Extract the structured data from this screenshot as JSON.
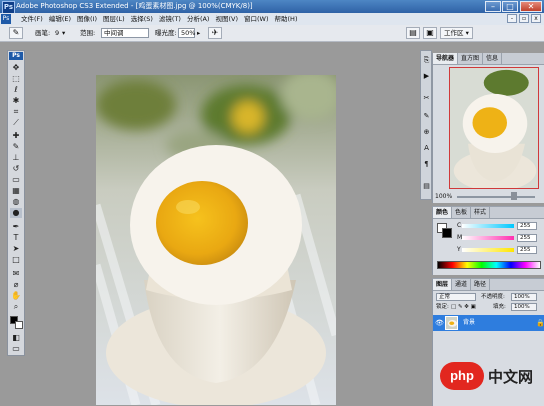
{
  "window": {
    "title": "Adobe Photoshop CS3 Extended - [鸡蛋素材图.jpg @ 100%(CMYK/8)]",
    "app_badge": "Ps"
  },
  "menu": {
    "items": [
      "文件(F)",
      "编辑(E)",
      "图像(I)",
      "图层(L)",
      "选择(S)",
      "滤镜(T)",
      "分析(A)",
      "视图(V)",
      "窗口(W)",
      "帮助(H)"
    ]
  },
  "options_bar": {
    "size_label": "画笔:",
    "size_value": "9",
    "range_label": "范围:",
    "range_value": "中间调",
    "exposure_label": "曝光度:",
    "exposure_value": "50%",
    "workspace_label": "工作区 ▾"
  },
  "toolbox": {
    "header": "Ps"
  },
  "navigator": {
    "tabs": [
      "导航器",
      "直方图",
      "信息"
    ],
    "zoom": "100%"
  },
  "color_panel": {
    "tabs": [
      "颜色",
      "色板",
      "样式"
    ],
    "channels": [
      {
        "label": "C",
        "value": "255"
      },
      {
        "label": "M",
        "value": "255"
      },
      {
        "label": "Y",
        "value": "255"
      }
    ]
  },
  "layers_panel": {
    "tabs": [
      "图层",
      "通道",
      "路径"
    ],
    "blend_mode": "正常",
    "opacity_label": "不透明度:",
    "opacity_value": "100%",
    "lock_label": "锁定:",
    "fill_label": "填充:",
    "fill_value": "100%",
    "layer_name": "背景"
  },
  "watermark": {
    "logo_text": "php",
    "site_text": "中文网"
  },
  "colors": {
    "accent": "#2e7dde",
    "titlebar": "#3a6cb0",
    "yolk": "#f1b817"
  }
}
